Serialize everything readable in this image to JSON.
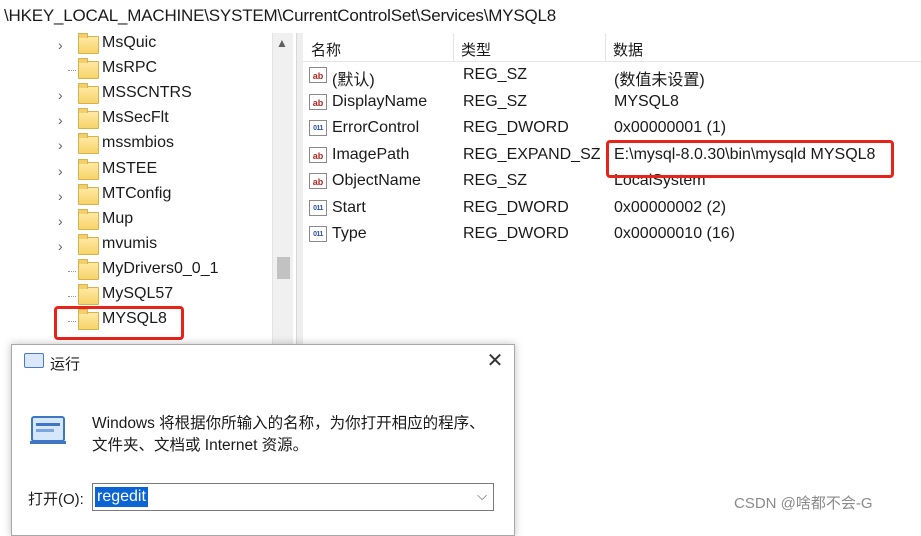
{
  "address_bar": {
    "path": "\\HKEY_LOCAL_MACHINE\\SYSTEM\\CurrentControlSet\\Services\\MYSQL8"
  },
  "tree": {
    "items": [
      {
        "label": "MsQuic",
        "expandable": true
      },
      {
        "label": "MsRPC",
        "expandable": false
      },
      {
        "label": "MSSCNTRS",
        "expandable": true
      },
      {
        "label": "MsSecFlt",
        "expandable": true
      },
      {
        "label": "mssmbios",
        "expandable": true
      },
      {
        "label": "MSTEE",
        "expandable": true
      },
      {
        "label": "MTConfig",
        "expandable": true
      },
      {
        "label": "Mup",
        "expandable": true
      },
      {
        "label": "mvumis",
        "expandable": true
      },
      {
        "label": "MyDrivers0_0_1",
        "expandable": false
      },
      {
        "label": "MySQL57",
        "expandable": false
      },
      {
        "label": "MYSQL8",
        "expandable": false,
        "selected": true
      }
    ]
  },
  "values_list": {
    "columns": {
      "name": "名称",
      "type": "类型",
      "data": "数据"
    },
    "rows": [
      {
        "icon": "string-value-icon",
        "name": "(默认)",
        "type": "REG_SZ",
        "data": "(数值未设置)"
      },
      {
        "icon": "string-value-icon",
        "name": "DisplayName",
        "type": "REG_SZ",
        "data": "MYSQL8"
      },
      {
        "icon": "binary-value-icon",
        "name": "ErrorControl",
        "type": "REG_DWORD",
        "data": "0x00000001 (1)"
      },
      {
        "icon": "string-value-icon",
        "name": "ImagePath",
        "type": "REG_EXPAND_SZ",
        "data": "E:\\mysql-8.0.30\\bin\\mysqld MYSQL8"
      },
      {
        "icon": "string-value-icon",
        "name": "ObjectName",
        "type": "REG_SZ",
        "data": "LocalSystem"
      },
      {
        "icon": "binary-value-icon",
        "name": "Start",
        "type": "REG_DWORD",
        "data": "0x00000002 (2)"
      },
      {
        "icon": "binary-value-icon",
        "name": "Type",
        "type": "REG_DWORD",
        "data": "0x00000010 (16)"
      }
    ],
    "highlight_color": "#e8231a"
  },
  "run_dialog": {
    "title": "运行",
    "close_glyph": "✕",
    "description_line1": "Windows 将根据你所输入的名称，为你打开相应的程序、",
    "description_line2": "文件夹、文档或 Internet 资源。",
    "open_label": "打开(O):",
    "input_value": "regedit"
  },
  "watermark": "CSDN @啥都不会-G"
}
